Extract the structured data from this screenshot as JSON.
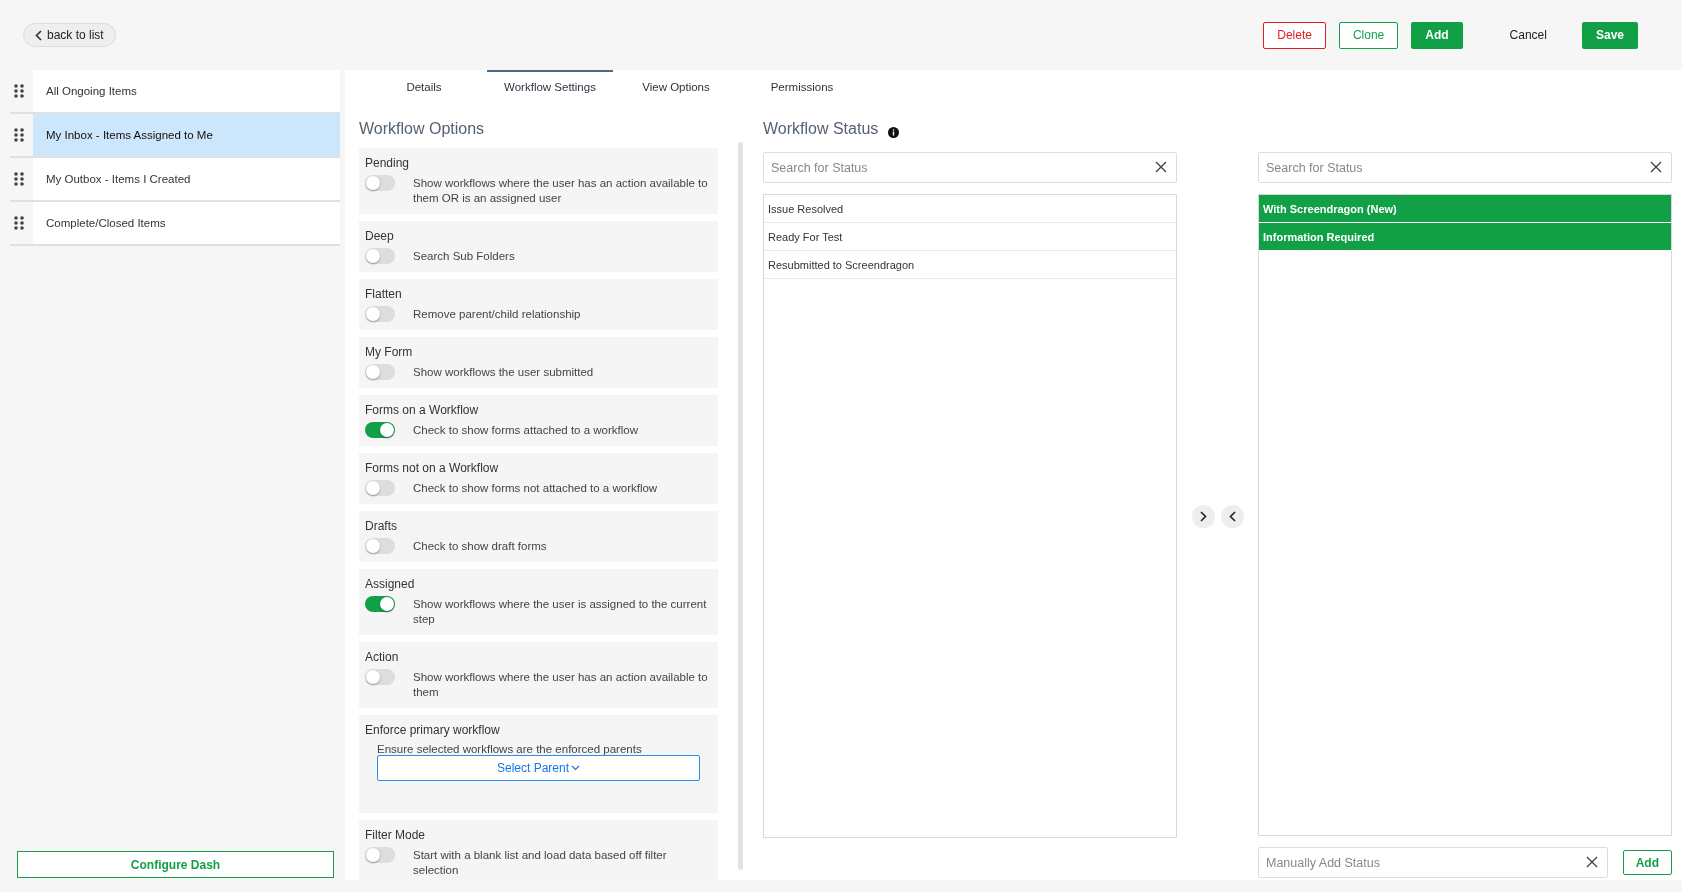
{
  "back_button": {
    "label": "back to list"
  },
  "actions": [
    {
      "label": "Delete",
      "kind": "danger"
    },
    {
      "label": "Clone",
      "kind": "outline"
    },
    {
      "label": "Add",
      "kind": "primary"
    },
    {
      "label": "Cancel",
      "kind": "plain"
    },
    {
      "label": "Save",
      "kind": "primary"
    }
  ],
  "sidebar": {
    "items": [
      {
        "label": "All Ongoing Items",
        "selected": false
      },
      {
        "label": "My Inbox - Items Assigned to Me",
        "selected": true
      },
      {
        "label": "My Outbox - Items I Created",
        "selected": false
      },
      {
        "label": "Complete/Closed Items",
        "selected": false
      }
    ],
    "footer_button": "Configure Dash"
  },
  "tabs": [
    {
      "label": "Details",
      "selected": false
    },
    {
      "label": "Workflow Settings",
      "selected": true
    },
    {
      "label": "View Options",
      "selected": false
    },
    {
      "label": "Permissions",
      "selected": false
    }
  ],
  "workflow_options": {
    "title": "Workflow Options",
    "options": [
      {
        "kind": "toggle",
        "label": "Pending",
        "description": "Show workflows where the user has an action available to them OR is an assigned user",
        "on": false
      },
      {
        "kind": "toggle",
        "label": "Deep",
        "description": "Search Sub Folders",
        "on": false
      },
      {
        "kind": "toggle",
        "label": "Flatten",
        "description": "Remove parent/child relationship",
        "on": false
      },
      {
        "kind": "toggle",
        "label": "My Form",
        "description": "Show workflows the user submitted",
        "on": false
      },
      {
        "kind": "toggle",
        "label": "Forms on a Workflow",
        "description": "Check to show forms attached to a workflow",
        "on": true
      },
      {
        "kind": "toggle",
        "label": "Forms not on a Workflow",
        "description": "Check to show forms not attached to a workflow",
        "on": false
      },
      {
        "kind": "toggle",
        "label": "Drafts",
        "description": "Check to show draft forms",
        "on": false
      },
      {
        "kind": "toggle",
        "label": "Assigned",
        "description": "Show workflows where the user is assigned to the current step",
        "on": true
      },
      {
        "kind": "toggle",
        "label": "Action",
        "description": "Show workflows where the user has an action available to them",
        "on": false
      },
      {
        "kind": "select",
        "label": "Enforce primary workflow",
        "description": "Ensure selected workflows are the enforced parents",
        "button": "Select Parent"
      },
      {
        "kind": "toggle",
        "label": "Filter Mode",
        "description": "Start with a blank list and load data based off filter selection",
        "on": false
      }
    ]
  },
  "workflow_status": {
    "title": "Workflow Status",
    "available": {
      "search_placeholder": "Search for Status",
      "items": [
        "Issue Resolved",
        "Ready For Test",
        "Resubmitted to Screendragon"
      ]
    },
    "chosen": {
      "search_placeholder": "Search for Status",
      "items": [
        "With Screendragon (New)",
        "Information Required"
      ]
    },
    "manual_placeholder": "Manually Add Status",
    "add_button": "Add"
  }
}
